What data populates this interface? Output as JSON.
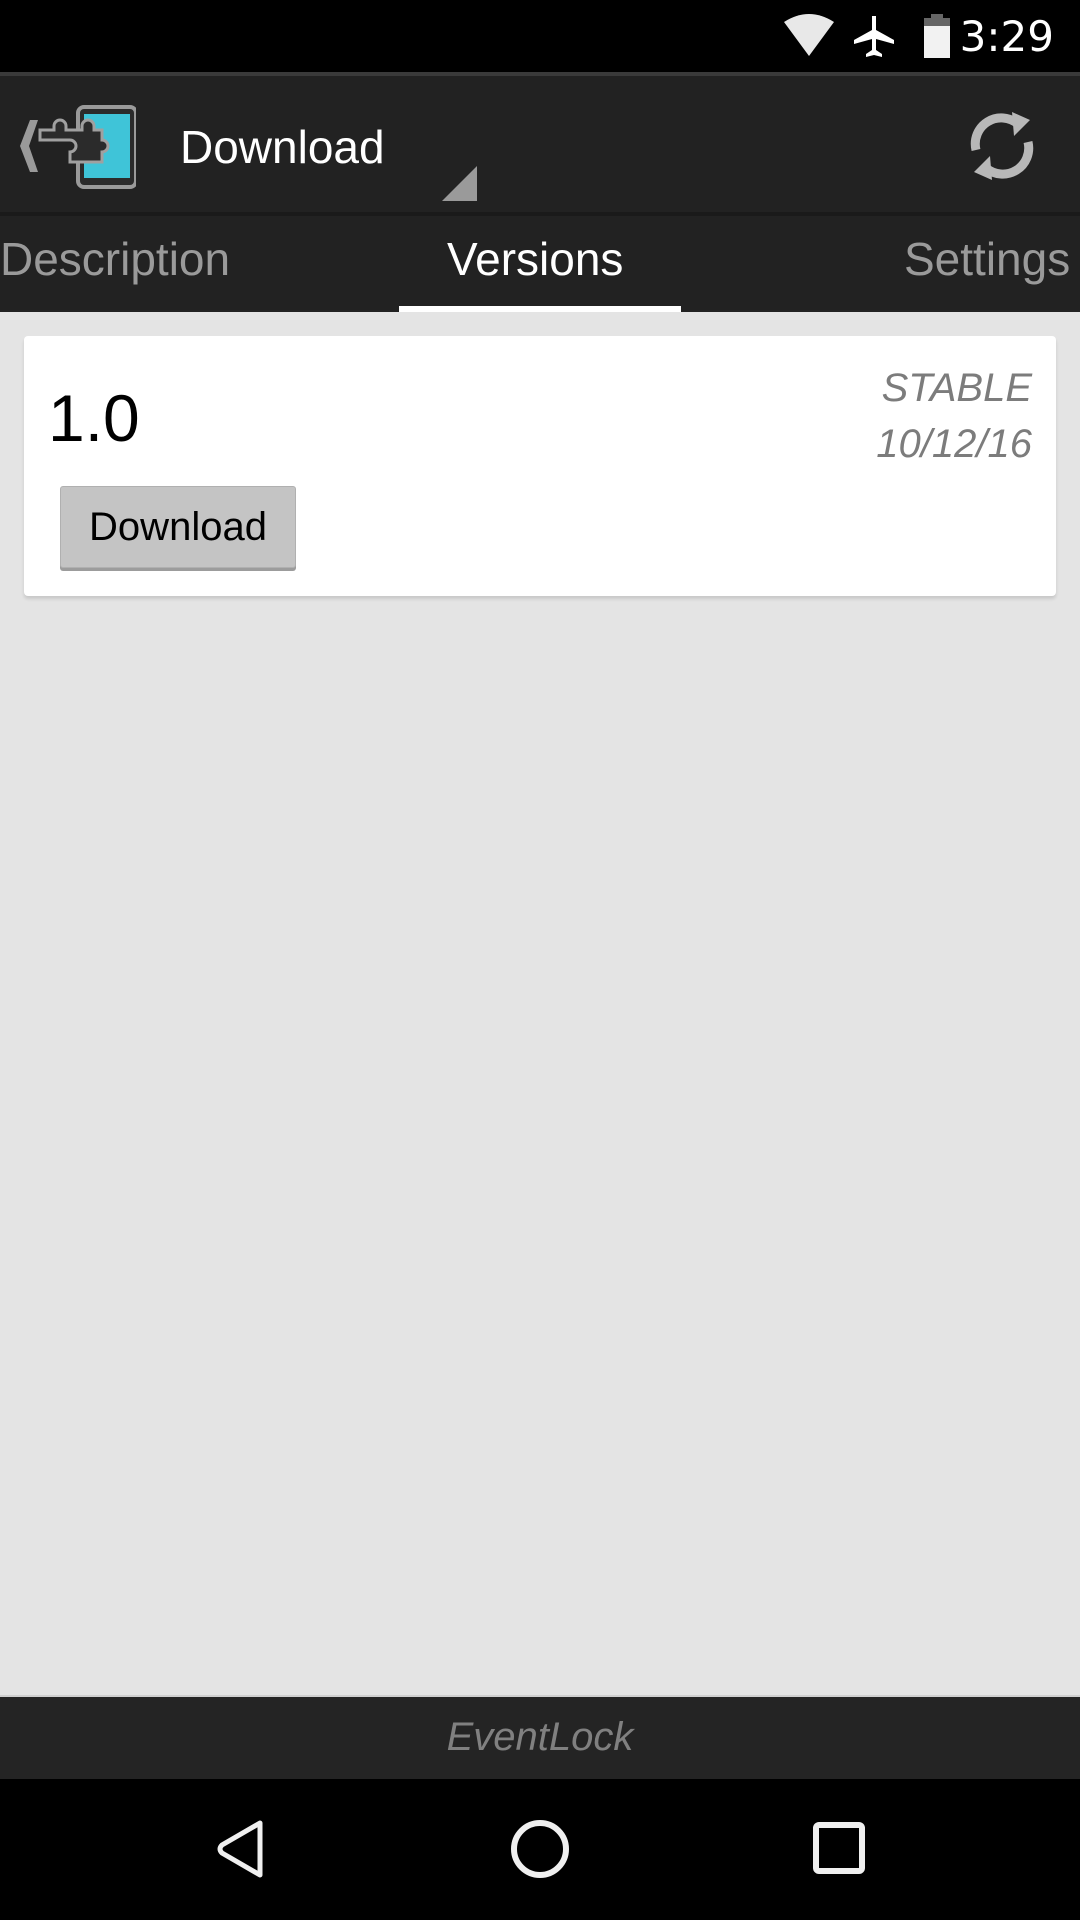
{
  "status_bar": {
    "time": "3:29",
    "icons": [
      "wifi-icon",
      "airplane-mode-icon",
      "battery-icon"
    ]
  },
  "action_bar": {
    "title": "Download",
    "app_icon": "xposed-installer-icon",
    "refresh_icon": "refresh-icon"
  },
  "tabs": [
    {
      "label": "Description",
      "active": false
    },
    {
      "label": "Versions",
      "active": true
    },
    {
      "label": "Settings",
      "active": false
    }
  ],
  "versions": [
    {
      "version": "1.0",
      "release_type": "STABLE",
      "date": "10/12/16",
      "button_label": "Download"
    }
  ],
  "footer": {
    "module_name": "EventLock"
  },
  "nav_bar": {
    "back": "back-icon",
    "home": "home-icon",
    "recents": "recents-icon"
  }
}
